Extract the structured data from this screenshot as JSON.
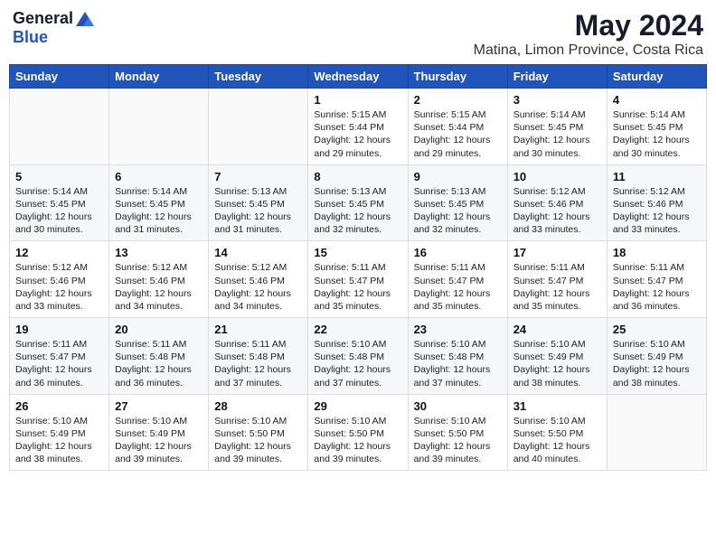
{
  "logo": {
    "general": "General",
    "blue": "Blue"
  },
  "title": "May 2024",
  "location": "Matina, Limon Province, Costa Rica",
  "days_of_week": [
    "Sunday",
    "Monday",
    "Tuesday",
    "Wednesday",
    "Thursday",
    "Friday",
    "Saturday"
  ],
  "weeks": [
    [
      {
        "day": "",
        "info": ""
      },
      {
        "day": "",
        "info": ""
      },
      {
        "day": "",
        "info": ""
      },
      {
        "day": "1",
        "info": "Sunrise: 5:15 AM\nSunset: 5:44 PM\nDaylight: 12 hours\nand 29 minutes."
      },
      {
        "day": "2",
        "info": "Sunrise: 5:15 AM\nSunset: 5:44 PM\nDaylight: 12 hours\nand 29 minutes."
      },
      {
        "day": "3",
        "info": "Sunrise: 5:14 AM\nSunset: 5:45 PM\nDaylight: 12 hours\nand 30 minutes."
      },
      {
        "day": "4",
        "info": "Sunrise: 5:14 AM\nSunset: 5:45 PM\nDaylight: 12 hours\nand 30 minutes."
      }
    ],
    [
      {
        "day": "5",
        "info": "Sunrise: 5:14 AM\nSunset: 5:45 PM\nDaylight: 12 hours\nand 30 minutes."
      },
      {
        "day": "6",
        "info": "Sunrise: 5:14 AM\nSunset: 5:45 PM\nDaylight: 12 hours\nand 31 minutes."
      },
      {
        "day": "7",
        "info": "Sunrise: 5:13 AM\nSunset: 5:45 PM\nDaylight: 12 hours\nand 31 minutes."
      },
      {
        "day": "8",
        "info": "Sunrise: 5:13 AM\nSunset: 5:45 PM\nDaylight: 12 hours\nand 32 minutes."
      },
      {
        "day": "9",
        "info": "Sunrise: 5:13 AM\nSunset: 5:45 PM\nDaylight: 12 hours\nand 32 minutes."
      },
      {
        "day": "10",
        "info": "Sunrise: 5:12 AM\nSunset: 5:46 PM\nDaylight: 12 hours\nand 33 minutes."
      },
      {
        "day": "11",
        "info": "Sunrise: 5:12 AM\nSunset: 5:46 PM\nDaylight: 12 hours\nand 33 minutes."
      }
    ],
    [
      {
        "day": "12",
        "info": "Sunrise: 5:12 AM\nSunset: 5:46 PM\nDaylight: 12 hours\nand 33 minutes."
      },
      {
        "day": "13",
        "info": "Sunrise: 5:12 AM\nSunset: 5:46 PM\nDaylight: 12 hours\nand 34 minutes."
      },
      {
        "day": "14",
        "info": "Sunrise: 5:12 AM\nSunset: 5:46 PM\nDaylight: 12 hours\nand 34 minutes."
      },
      {
        "day": "15",
        "info": "Sunrise: 5:11 AM\nSunset: 5:47 PM\nDaylight: 12 hours\nand 35 minutes."
      },
      {
        "day": "16",
        "info": "Sunrise: 5:11 AM\nSunset: 5:47 PM\nDaylight: 12 hours\nand 35 minutes."
      },
      {
        "day": "17",
        "info": "Sunrise: 5:11 AM\nSunset: 5:47 PM\nDaylight: 12 hours\nand 35 minutes."
      },
      {
        "day": "18",
        "info": "Sunrise: 5:11 AM\nSunset: 5:47 PM\nDaylight: 12 hours\nand 36 minutes."
      }
    ],
    [
      {
        "day": "19",
        "info": "Sunrise: 5:11 AM\nSunset: 5:47 PM\nDaylight: 12 hours\nand 36 minutes."
      },
      {
        "day": "20",
        "info": "Sunrise: 5:11 AM\nSunset: 5:48 PM\nDaylight: 12 hours\nand 36 minutes."
      },
      {
        "day": "21",
        "info": "Sunrise: 5:11 AM\nSunset: 5:48 PM\nDaylight: 12 hours\nand 37 minutes."
      },
      {
        "day": "22",
        "info": "Sunrise: 5:10 AM\nSunset: 5:48 PM\nDaylight: 12 hours\nand 37 minutes."
      },
      {
        "day": "23",
        "info": "Sunrise: 5:10 AM\nSunset: 5:48 PM\nDaylight: 12 hours\nand 37 minutes."
      },
      {
        "day": "24",
        "info": "Sunrise: 5:10 AM\nSunset: 5:49 PM\nDaylight: 12 hours\nand 38 minutes."
      },
      {
        "day": "25",
        "info": "Sunrise: 5:10 AM\nSunset: 5:49 PM\nDaylight: 12 hours\nand 38 minutes."
      }
    ],
    [
      {
        "day": "26",
        "info": "Sunrise: 5:10 AM\nSunset: 5:49 PM\nDaylight: 12 hours\nand 38 minutes."
      },
      {
        "day": "27",
        "info": "Sunrise: 5:10 AM\nSunset: 5:49 PM\nDaylight: 12 hours\nand 39 minutes."
      },
      {
        "day": "28",
        "info": "Sunrise: 5:10 AM\nSunset: 5:50 PM\nDaylight: 12 hours\nand 39 minutes."
      },
      {
        "day": "29",
        "info": "Sunrise: 5:10 AM\nSunset: 5:50 PM\nDaylight: 12 hours\nand 39 minutes."
      },
      {
        "day": "30",
        "info": "Sunrise: 5:10 AM\nSunset: 5:50 PM\nDaylight: 12 hours\nand 39 minutes."
      },
      {
        "day": "31",
        "info": "Sunrise: 5:10 AM\nSunset: 5:50 PM\nDaylight: 12 hours\nand 40 minutes."
      },
      {
        "day": "",
        "info": ""
      }
    ]
  ]
}
